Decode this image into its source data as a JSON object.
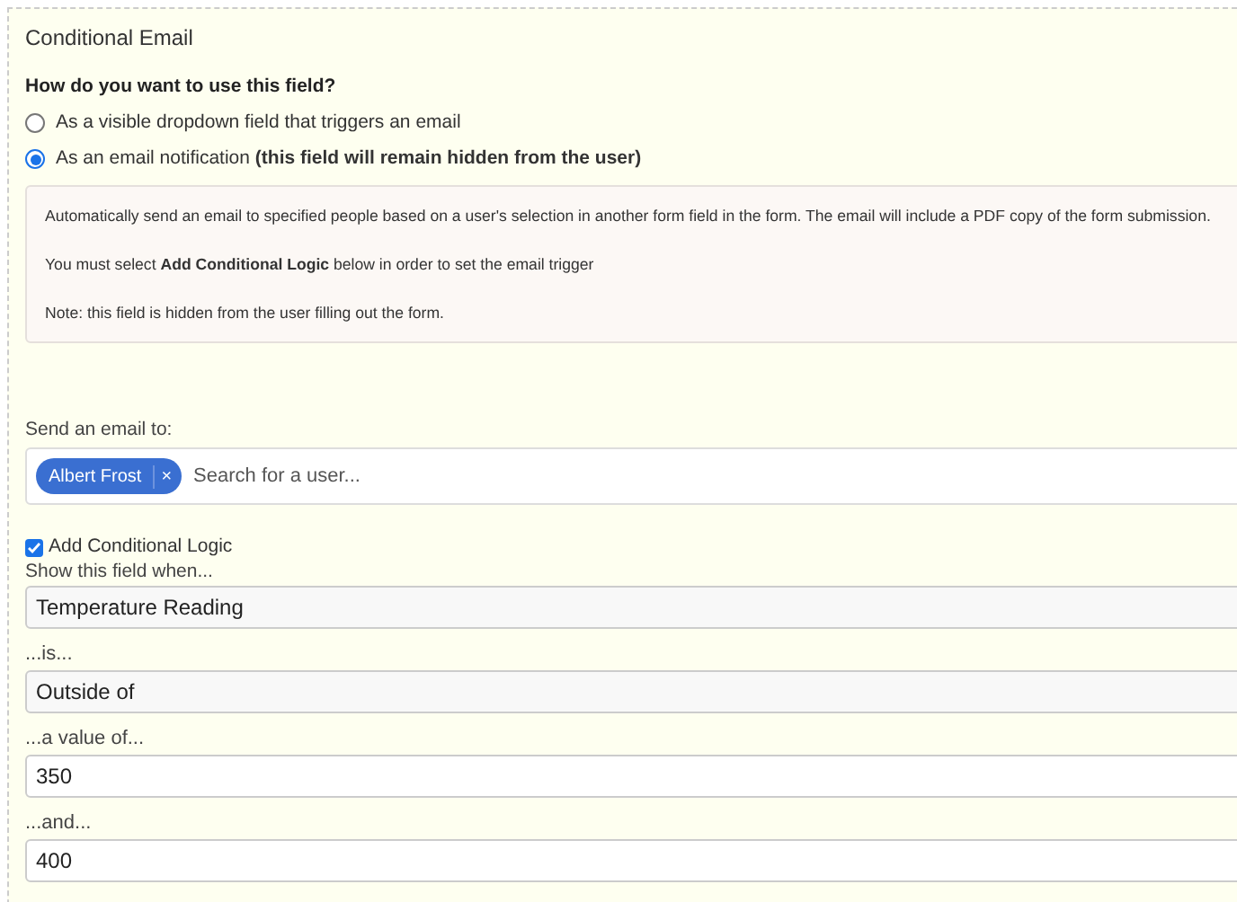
{
  "panel": {
    "title": "Conditional Email"
  },
  "usage": {
    "question": "How do you want to use this field?",
    "options": [
      {
        "label": "As a visible dropdown field that triggers an email",
        "selected": false
      },
      {
        "label": "As an email notification **(this field will remain hidden from the user)**",
        "selected": true
      }
    ]
  },
  "info_box": {
    "paragraphs": [
      "Automatically send an email to specified people based on a user's selection in another form field in the form. The email will include a PDF copy of the form submission.",
      "You must select **Add Conditional Logic** below in order to set the email trigger",
      "Note: this field is hidden from the user filling out the form."
    ]
  },
  "recipients": {
    "label": "Send an email to:",
    "tags": [
      {
        "name": "Albert Frost",
        "remove": "×"
      }
    ],
    "placeholder": "Search for a user..."
  },
  "conditional_logic": {
    "label": "Add Conditional Logic",
    "checked": true,
    "intro": "Show this field when...",
    "fields": [
      {
        "kind": "select",
        "value": "Temperature Reading"
      },
      {
        "label": "...is...",
        "kind": "select",
        "value": "Outside of"
      },
      {
        "label": "...a value of...",
        "kind": "input",
        "value": "350"
      },
      {
        "label": "...and...",
        "kind": "input",
        "value": "400"
      }
    ]
  }
}
